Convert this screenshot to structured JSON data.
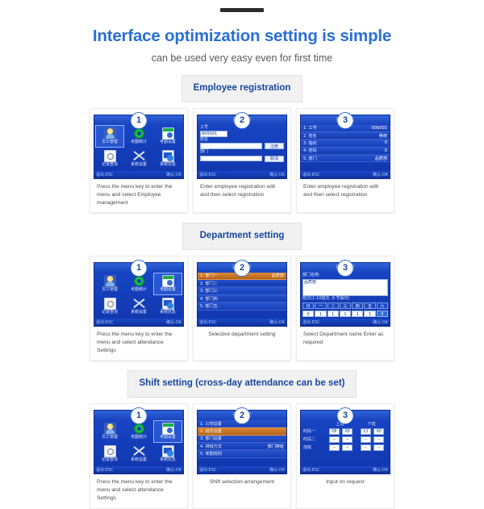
{
  "header": {
    "headline": "Interface optimization setting is simple",
    "subhead": "can be used very easy even for first time"
  },
  "sections": [
    {
      "chip": "Employee registration",
      "cards": [
        {
          "badge": "1",
          "caption": "Press the menu key to enter the menu and select Employee management",
          "caption_align": "left",
          "screen": {
            "kind": "menu",
            "title": "菜单",
            "selected_index": 0,
            "items": [
              {
                "label": "员工管理",
                "icon": "person-icon"
              },
              {
                "label": "考勤统计",
                "icon": "recycle-icon"
              },
              {
                "label": "考勤设置",
                "icon": "calendar-icon"
              },
              {
                "label": "记录查询",
                "icon": "document-search-icon"
              },
              {
                "label": "系统设置",
                "icon": "tools-icon"
              },
              {
                "label": "系统信息",
                "icon": "monitor-icon"
              }
            ],
            "foot_left": "退出:ESC",
            "foot_right": "确认:OK"
          }
        },
        {
          "badge": "2",
          "caption": "Enter employee registration edit and then select registration",
          "caption_align": "left",
          "screen": {
            "kind": "form",
            "title": "员工注册",
            "fields": [
              {
                "label": "工号",
                "value": "000001",
                "short": true,
                "button": ""
              },
              {
                "label": "姓名",
                "value": "",
                "short": false,
                "button": "注册"
              },
              {
                "label": "部门",
                "value": "",
                "short": false,
                "button": "取消"
              }
            ],
            "foot_left": "退出:ESC",
            "foot_right": "确认:OK"
          }
        },
        {
          "badge": "3",
          "caption": "Enter employee registration edit and then select registration",
          "caption_align": "left",
          "screen": {
            "kind": "list",
            "title": "员工信息",
            "selected_index": -1,
            "rows": [
              {
                "label": "1. 工号",
                "value": "000001"
              },
              {
                "label": "2. 姓名",
                "value": "吴晓"
              },
              {
                "label": "3. 指纹",
                "value": "0"
              },
              {
                "label": "4. 密码",
                "value": "0"
              },
              {
                "label": "5. 部门",
                "value": "品质部"
              }
            ],
            "foot_left": "退出:ESC",
            "foot_right": "确认:OK"
          }
        }
      ]
    },
    {
      "chip": "Department setting",
      "cards": [
        {
          "badge": "1",
          "caption": "Press the menu key to enter the menu and select attendance Settings",
          "caption_align": "left",
          "screen": {
            "kind": "menu",
            "title": "菜单",
            "selected_index": 2,
            "items": [
              {
                "label": "员工管理",
                "icon": "person-icon"
              },
              {
                "label": "考勤统计",
                "icon": "recycle-icon"
              },
              {
                "label": "考勤设置",
                "icon": "calendar-icon"
              },
              {
                "label": "记录查询",
                "icon": "document-search-icon"
              },
              {
                "label": "系统设置",
                "icon": "tools-icon"
              },
              {
                "label": "系统信息",
                "icon": "monitor-icon"
              }
            ],
            "foot_left": "退出:ESC",
            "foot_right": "确认:OK"
          }
        },
        {
          "badge": "2",
          "caption": "Selective department setting",
          "caption_align": "center",
          "screen": {
            "kind": "list",
            "title": "部门设置",
            "selected_index": 0,
            "rows": [
              {
                "label": "1. 部门一",
                "value": "品质部"
              },
              {
                "label": "2. 部门二",
                "value": ""
              },
              {
                "label": "3. 部门三",
                "value": ""
              },
              {
                "label": "4. 部门四",
                "value": ""
              },
              {
                "label": "5. 部门五",
                "value": ""
              }
            ],
            "foot_left": "退出:ESC",
            "foot_right": "确认:OK"
          }
        },
        {
          "badge": "3",
          "caption": "Select Department name Enter as required",
          "caption_align": "left",
          "screen": {
            "kind": "dept",
            "title": "部门设置",
            "name_label": "部门名称:",
            "name_value": "品质部",
            "shift_label": "班次(1-10班次, 0-节假日)",
            "weekdays": [
              "日",
              "一",
              "二",
              "三",
              "四",
              "五",
              "六"
            ],
            "weekvalues": [
              "0",
              "1",
              "1",
              "1",
              "1",
              "1",
              "0"
            ],
            "highlight_index": 6,
            "foot_left": "退出:ESC",
            "foot_right": "确认:OK"
          }
        }
      ]
    },
    {
      "chip": "Shift setting (cross-day attendance can be set)",
      "cards": [
        {
          "badge": "1",
          "caption": "Press the menu key to enter the menu and select attendance Settings",
          "caption_align": "left",
          "screen": {
            "kind": "menu",
            "title": "菜单",
            "selected_index": 2,
            "items": [
              {
                "label": "员工管理",
                "icon": "person-icon"
              },
              {
                "label": "考勤统计",
                "icon": "recycle-icon"
              },
              {
                "label": "考勤设置",
                "icon": "calendar-icon"
              },
              {
                "label": "记录查询",
                "icon": "document-search-icon"
              },
              {
                "label": "系统设置",
                "icon": "tools-icon"
              },
              {
                "label": "系统信息",
                "icon": "monitor-icon"
              }
            ],
            "foot_left": "退出:ESC",
            "foot_right": "确认:OK"
          }
        },
        {
          "badge": "2",
          "caption": "Shift selection arrangement",
          "caption_align": "center",
          "screen": {
            "kind": "list",
            "title": "考勤设置",
            "selected_index": 1,
            "rows": [
              {
                "label": "1. 公司设置",
                "value": ""
              },
              {
                "label": "2. 班次设置",
                "value": ""
              },
              {
                "label": "3. 部门设置",
                "value": ""
              },
              {
                "label": "4. 排班方式",
                "value": "部门排班"
              },
              {
                "label": "5. 考勤规则",
                "value": ""
              }
            ],
            "foot_left": "退出:ESC",
            "foot_right": "确认:OK"
          }
        },
        {
          "badge": "3",
          "caption": "Input on request",
          "caption_align": "center",
          "screen": {
            "kind": "time",
            "title": "班次一",
            "col_in": "上班",
            "col_out": "下班",
            "rows": [
              {
                "label": "时段一",
                "in_h": "08",
                "in_m": "00",
                "out_h": "12",
                "out_m": "00"
              },
              {
                "label": "时段二",
                "in_h": "--",
                "in_m": "--",
                "out_h": "--",
                "out_m": "--"
              },
              {
                "label": "加班",
                "in_h": "--",
                "in_m": "--",
                "out_h": "--",
                "out_m": "--"
              }
            ],
            "foot_left": "退出:ESC",
            "foot_right": "确认:OK"
          }
        }
      ]
    }
  ]
}
